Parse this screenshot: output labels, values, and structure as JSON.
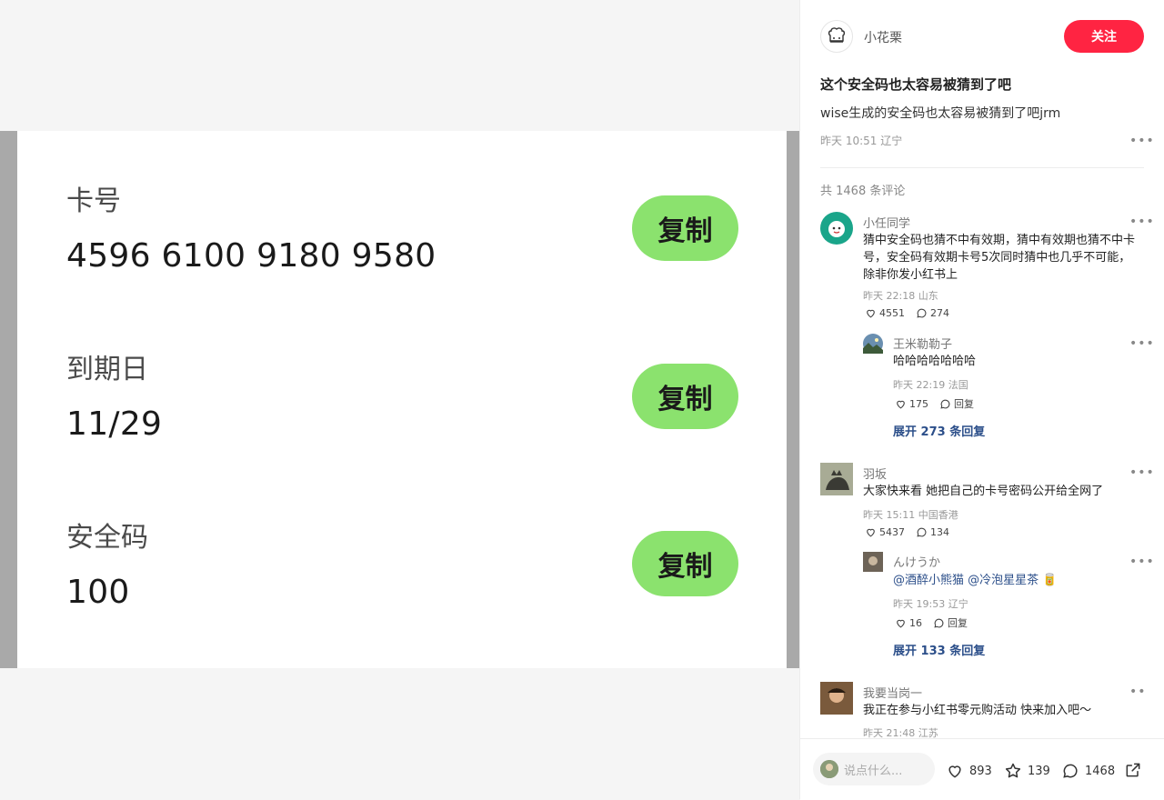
{
  "card": {
    "fields": [
      {
        "label": "卡号",
        "value": "4596 6100 9180 9580"
      },
      {
        "label": "到期日",
        "value": "11/29"
      },
      {
        "label": "安全码",
        "value": "100"
      }
    ],
    "copy_label": "复制",
    "copy_button_color": "#8be26e"
  },
  "post": {
    "author": {
      "name": "小花栗",
      "avatar_icon": "chef-hat-avatar"
    },
    "follow_label": "关注",
    "follow_color": "#ff2442",
    "title": "这个安全码也太容易被猜到了吧",
    "body": "wise生成的安全码也太容易被猜到了吧jrm",
    "meta": "昨天 10:51 辽宁",
    "comment_count": "共 1468 条评论"
  },
  "comments": [
    {
      "user": "小任同学",
      "text": "猜中安全码也猜不中有效期，猜中有效期也猜不中卡号，安全码有效期卡号5次同时猜中也几乎不可能，除非你发小红书上",
      "meta": "昨天 22:18 山东",
      "likes": "4551",
      "replies": "274",
      "sub": {
        "user": "王米勒勒子",
        "text": "哈哈哈哈哈哈哈",
        "meta": "昨天 22:19 法国",
        "likes": "175",
        "reply_label": "回复"
      },
      "expand": "展开 273 条回复"
    },
    {
      "user": "羽坂",
      "text": "大家快来看 她把自己的卡号密码公开给全网了",
      "meta": "昨天 15:11 中国香港",
      "likes": "5437",
      "replies": "134",
      "sub": {
        "user": "んけうか",
        "mention1": "@酒醉小熊猫",
        "mention2": "@冷泡星星茶",
        "meta": "昨天 19:53 辽宁",
        "likes": "16",
        "reply_label": "回复"
      },
      "expand": "展开 133 条回复"
    },
    {
      "user": "我要当岗一",
      "text": "我正在参与小红书零元购活动 快来加入吧～",
      "meta": "昨天 21:48 江苏"
    }
  ],
  "bottom": {
    "placeholder": "说点什么...",
    "likes": "893",
    "stars": "139",
    "comments": "1468"
  }
}
